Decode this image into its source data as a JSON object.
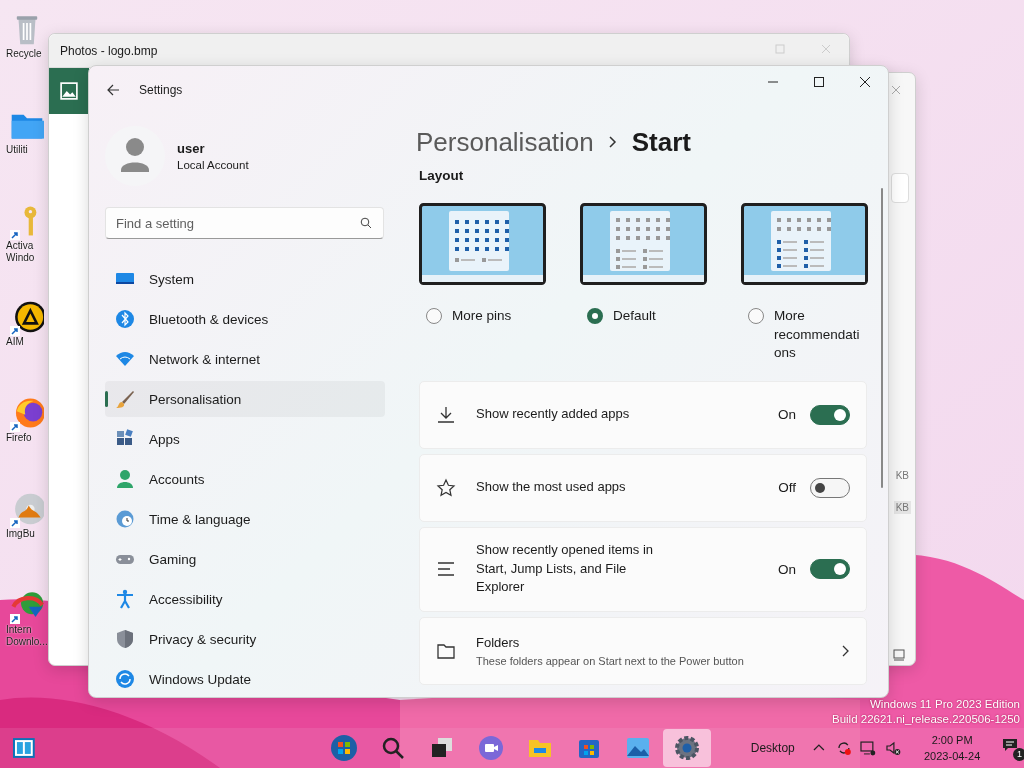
{
  "desktop_icons": [
    {
      "label": "Recycle",
      "kind": "bin",
      "shortcut": false
    },
    {
      "label": "Utiliti",
      "kind": "folder",
      "shortcut": false
    },
    {
      "label": "Activa\nWindo",
      "kind": "key",
      "shortcut": true
    },
    {
      "label": "AIM",
      "kind": "aimp",
      "shortcut": true
    },
    {
      "label": "Firefo",
      "kind": "firefox",
      "shortcut": true
    },
    {
      "label": "ImgBu",
      "kind": "disc",
      "shortcut": true
    },
    {
      "label": "Intern\nDownlo...",
      "kind": "download",
      "shortcut": true
    }
  ],
  "photos_window": {
    "title": "Photos - logo.bmp"
  },
  "back_window": {
    "sizes": [
      "KB",
      "KB"
    ]
  },
  "settings": {
    "title": "Settings",
    "account": {
      "name": "user",
      "type": "Local Account"
    },
    "search": {
      "placeholder": "Find a setting"
    },
    "nav": [
      {
        "label": "System",
        "selected": false
      },
      {
        "label": "Bluetooth & devices",
        "selected": false
      },
      {
        "label": "Network & internet",
        "selected": false
      },
      {
        "label": "Personalisation",
        "selected": true
      },
      {
        "label": "Apps",
        "selected": false
      },
      {
        "label": "Accounts",
        "selected": false
      },
      {
        "label": "Time & language",
        "selected": false
      },
      {
        "label": "Gaming",
        "selected": false
      },
      {
        "label": "Accessibility",
        "selected": false
      },
      {
        "label": "Privacy & security",
        "selected": false
      },
      {
        "label": "Windows Update",
        "selected": false
      }
    ],
    "breadcrumb": {
      "parent": "Personalisation",
      "current": "Start"
    },
    "section": "Layout",
    "layouts": [
      {
        "label": "More pins",
        "kind": "pins",
        "selected": false
      },
      {
        "label": "Default",
        "kind": "default",
        "selected": true
      },
      {
        "label": "More recommendations",
        "kind": "recommendations",
        "selected": false
      }
    ],
    "rows": [
      {
        "kind": "toggle",
        "label": "Show recently added apps",
        "state": "On",
        "on": true
      },
      {
        "kind": "toggle",
        "label": "Show the most used apps",
        "state": "Off",
        "on": false
      },
      {
        "kind": "toggle",
        "label": "Show recently opened items in Start, Jump Lists, and File Explorer",
        "state": "On",
        "on": true
      },
      {
        "kind": "link",
        "label": "Folders",
        "description": "These folders appear on Start next to the Power button"
      }
    ]
  },
  "edition": [
    "Windows 11 Pro 2023 Edition",
    "Build 22621.ni_release.220506-1250"
  ],
  "taskbar": {
    "apps": [
      {
        "kind": "start",
        "selected": false
      },
      {
        "kind": "search",
        "selected": false
      },
      {
        "kind": "taskview",
        "selected": false
      },
      {
        "kind": "chat",
        "selected": false
      },
      {
        "kind": "explorer",
        "selected": false
      },
      {
        "kind": "store",
        "selected": false
      },
      {
        "kind": "photos",
        "selected": false
      },
      {
        "kind": "settings",
        "selected": true
      }
    ],
    "desktop_label": "Desktop",
    "time": "2:00 PM",
    "date": "2023-04-24",
    "notifications": "1"
  }
}
